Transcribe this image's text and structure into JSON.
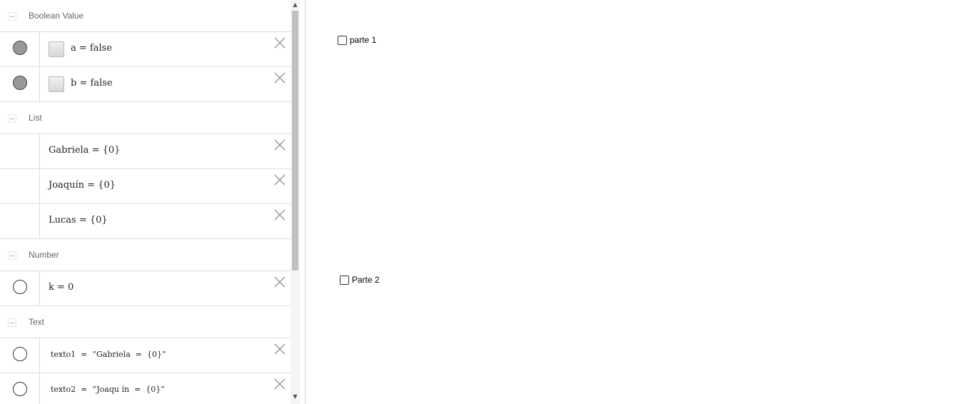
{
  "algebra": {
    "groups": {
      "boolean": {
        "label": "Boolean Value"
      },
      "list": {
        "label": "List"
      },
      "number": {
        "label": "Number"
      },
      "text": {
        "label": "Text"
      }
    },
    "rows": {
      "a": {
        "expr": "a = false"
      },
      "b": {
        "expr": "b = false"
      },
      "gabriela": {
        "expr": "Gabriela = {0}"
      },
      "joaquin": {
        "expr": "Joaquín = {0}"
      },
      "lucas": {
        "expr": "Lucas = {0}"
      },
      "k": {
        "expr": "k = 0"
      },
      "texto1": {
        "expr": "texto1  =  “Gabriela  =  {0}”"
      },
      "texto2": {
        "expr": "texto2  =  “Joaqu ín  =  {0}”"
      }
    }
  },
  "scrollbar": {
    "up": "▲",
    "down": "▼"
  },
  "graphics": {
    "checkbox1": {
      "label": "parte 1",
      "checked": false
    },
    "checkbox2": {
      "label": "Parte 2",
      "checked": false
    }
  }
}
